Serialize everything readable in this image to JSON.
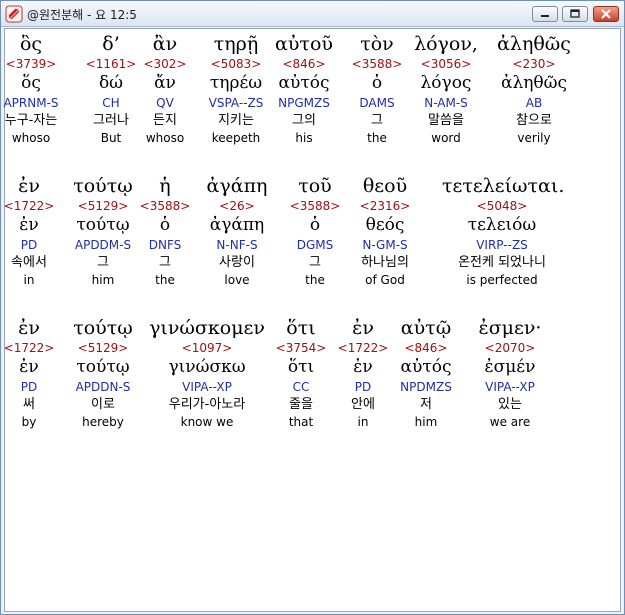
{
  "window": {
    "title": "@원전분해 - 요 12:5",
    "app_icon": "bible-app-icon",
    "min_icon": "minimize-icon",
    "max_icon": "maximize-icon",
    "close_icon": "close-icon",
    "colors": {
      "strong": "#a01010",
      "parse": "#1f2ea8",
      "close": "#c8432c"
    }
  },
  "rows": [
    {
      "words": [
        {
          "greek": "ὃς",
          "strong": "<3739>",
          "lemma": "ὅς",
          "parse": "APRNM-S",
          "korean": "누구-자는",
          "english": "whoso"
        },
        {
          "greek": "δ’",
          "strong": "<1161>",
          "lemma": "δώ",
          "parse": "CH",
          "korean": "그러나",
          "english": "But"
        },
        {
          "greek": "ἂν",
          "strong": "<302>",
          "lemma": "ἄν",
          "parse": "QV",
          "korean": "든지",
          "english": "whoso"
        },
        {
          "greek": "τηρῇ",
          "strong": "<5083>",
          "lemma": "τηρέω",
          "parse": "VSPA--ZS",
          "korean": "지키는",
          "english": "keepeth"
        },
        {
          "greek": "αὐτοῦ",
          "strong": "<846>",
          "lemma": "αὐτός",
          "parse": "NPGMZS",
          "korean": "그의",
          "english": "his"
        },
        {
          "greek": "τὸν",
          "strong": "<3588>",
          "lemma": "ὁ",
          "parse": "DAMS",
          "korean": "그",
          "english": "the"
        },
        {
          "greek": "λόγον,",
          "strong": "<3056>",
          "lemma": "λόγος",
          "parse": "N-AM-S",
          "korean": "말씀을",
          "english": "word"
        },
        {
          "greek": "ἀληθῶς",
          "strong": "<230>",
          "lemma": "ἀληθῶς",
          "parse": "AB",
          "korean": "참으로",
          "english": "verily"
        }
      ]
    },
    {
      "words": [
        {
          "greek": "ἐν",
          "strong": "<1722>",
          "lemma": "ἐν",
          "parse": "PD",
          "korean": "속에서",
          "english": "in"
        },
        {
          "greek": "τούτῳ",
          "strong": "<5129>",
          "lemma": "τούτῳ",
          "parse": "APDDM-S",
          "korean": "그",
          "english": "him"
        },
        {
          "greek": "ἡ",
          "strong": "<3588>",
          "lemma": "ὁ",
          "parse": "DNFS",
          "korean": "그",
          "english": "the"
        },
        {
          "greek": "ἀγάπη",
          "strong": "<26>",
          "lemma": "ἀγάπη",
          "parse": "N-NF-S",
          "korean": "사랑이",
          "english": "love"
        },
        {
          "greek": "τοῦ",
          "strong": "<3588>",
          "lemma": "ὁ",
          "parse": "DGMS",
          "korean": "그",
          "english": "the"
        },
        {
          "greek": "θεοῦ",
          "strong": "<2316>",
          "lemma": "θεός",
          "parse": "N-GM-S",
          "korean": "하나님의",
          "english": "of God"
        },
        {
          "greek": "τετελείωται.",
          "strong": "<5048>",
          "lemma": "τελειόω",
          "parse": "VIRP--ZS",
          "korean": "온전케 되었나니",
          "english": "is perfected"
        }
      ]
    },
    {
      "words": [
        {
          "greek": "ἐν",
          "strong": "<1722>",
          "lemma": "ἐν",
          "parse": "PD",
          "korean": "써",
          "english": "by"
        },
        {
          "greek": "τούτῳ",
          "strong": "<5129>",
          "lemma": "τούτῳ",
          "parse": "APDDN-S",
          "korean": "이로",
          "english": "hereby"
        },
        {
          "greek": "γινώσκομεν",
          "strong": "<1097>",
          "lemma": "γινώσκω",
          "parse": "VIPA--XP",
          "korean": "우리가-아노라",
          "english": "know we"
        },
        {
          "greek": "ὅτι",
          "strong": "<3754>",
          "lemma": "ὅτι",
          "parse": "CC",
          "korean": "줄을",
          "english": "that"
        },
        {
          "greek": "ἐν",
          "strong": "<1722>",
          "lemma": "ἐν",
          "parse": "PD",
          "korean": "안에",
          "english": "in"
        },
        {
          "greek": "αὐτῷ",
          "strong": "<846>",
          "lemma": "αὐτός",
          "parse": "NPDMZS",
          "korean": "저",
          "english": "him"
        },
        {
          "greek": "ἐσμεν·",
          "strong": "<2070>",
          "lemma": "ἐσμέν",
          "parse": "VIPA--XP",
          "korean": "있는",
          "english": "we are"
        }
      ]
    }
  ]
}
